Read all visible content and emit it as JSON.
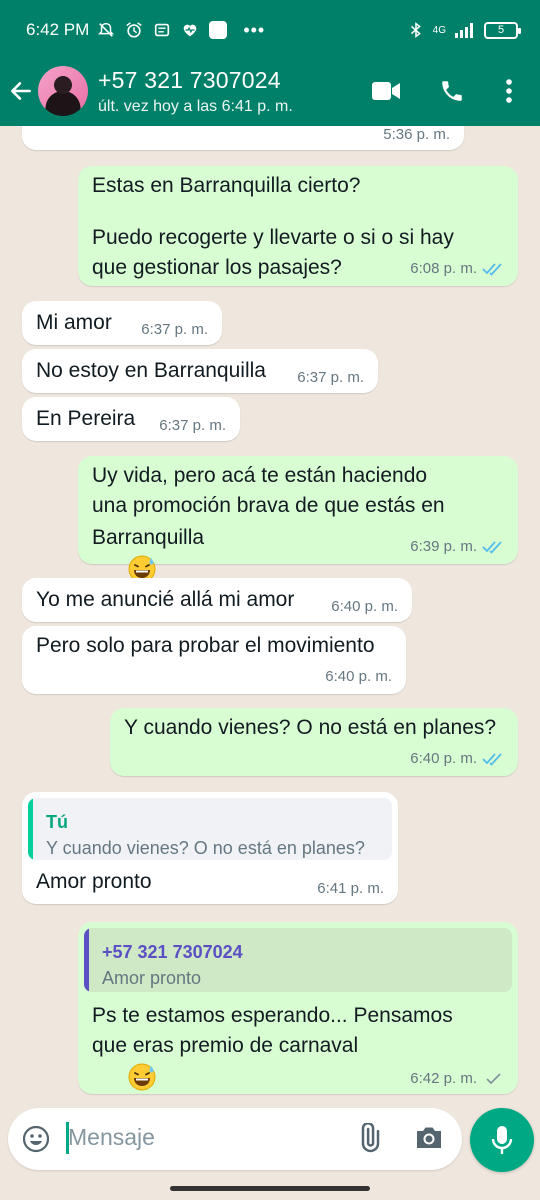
{
  "status_bar": {
    "time": "6:42 PM",
    "network": "4G",
    "battery": "5",
    "icons": [
      "mute-icon",
      "alarm-icon",
      "notification-icon",
      "health-icon",
      "app-icon",
      "more-icon",
      "bluetooth-icon",
      "signal-icon",
      "battery-icon"
    ]
  },
  "header": {
    "contact_name": "+57 321 7307024",
    "last_seen": "últ. vez hoy a las 6:41 p. m.",
    "actions": [
      "video-call-icon",
      "phone-icon",
      "more-vert-icon"
    ]
  },
  "colors": {
    "header_bg": "#008069",
    "chat_bg": "#efe7de",
    "outgoing_bubble": "#d9fdd3",
    "incoming_bubble": "#ffffff",
    "read_ticks": "#53bdeb",
    "accent": "#00a884"
  },
  "messages": [
    {
      "dir": "in",
      "text": "",
      "time": "5:36 p. m."
    },
    {
      "dir": "out",
      "lines": [
        "Estas en Barranquilla cierto?",
        "",
        "Puedo recogerte y llevarte o si o si hay",
        "que gestionar los pasajes?"
      ],
      "time": "6:08 p. m.",
      "status": "read"
    },
    {
      "dir": "in",
      "text": "Mi amor",
      "time": "6:37 p. m."
    },
    {
      "dir": "in",
      "text": "No estoy en Barranquilla",
      "time": "6:37 p. m."
    },
    {
      "dir": "in",
      "text": "En Pereira",
      "time": "6:37 p. m."
    },
    {
      "dir": "out",
      "lines": [
        "Uy vida, pero acá te están haciendo",
        "una promoción brava de que estás en",
        "Barranquilla"
      ],
      "emoji": "grinning-sweat-emoji",
      "time": "6:39 p. m.",
      "status": "read"
    },
    {
      "dir": "in",
      "text": "Yo me anuncié allá mi amor",
      "time": "6:40 p. m."
    },
    {
      "dir": "in",
      "text": "Pero solo para probar el movimiento",
      "time": "6:40 p. m."
    },
    {
      "dir": "out",
      "text": "Y cuando vienes? O no está en planes?",
      "time": "6:40 p. m.",
      "status": "read"
    },
    {
      "dir": "in",
      "quote": {
        "author": "Tú",
        "text": "Y cuando vienes? O no está en planes?"
      },
      "text": "Amor pronto",
      "time": "6:41 p. m."
    },
    {
      "dir": "out",
      "quote": {
        "author": "+57 321 7307024",
        "text": "Amor pronto"
      },
      "lines": [
        "Ps te estamos esperando... Pensamos",
        "que eras premio de carnaval"
      ],
      "emoji": "grinning-sweat-emoji",
      "time": "6:42 p. m.",
      "status": "sent"
    }
  ],
  "input": {
    "placeholder": "Mensaje",
    "icons": [
      "emoji-icon",
      "attach-icon",
      "camera-icon",
      "mic-icon"
    ]
  }
}
